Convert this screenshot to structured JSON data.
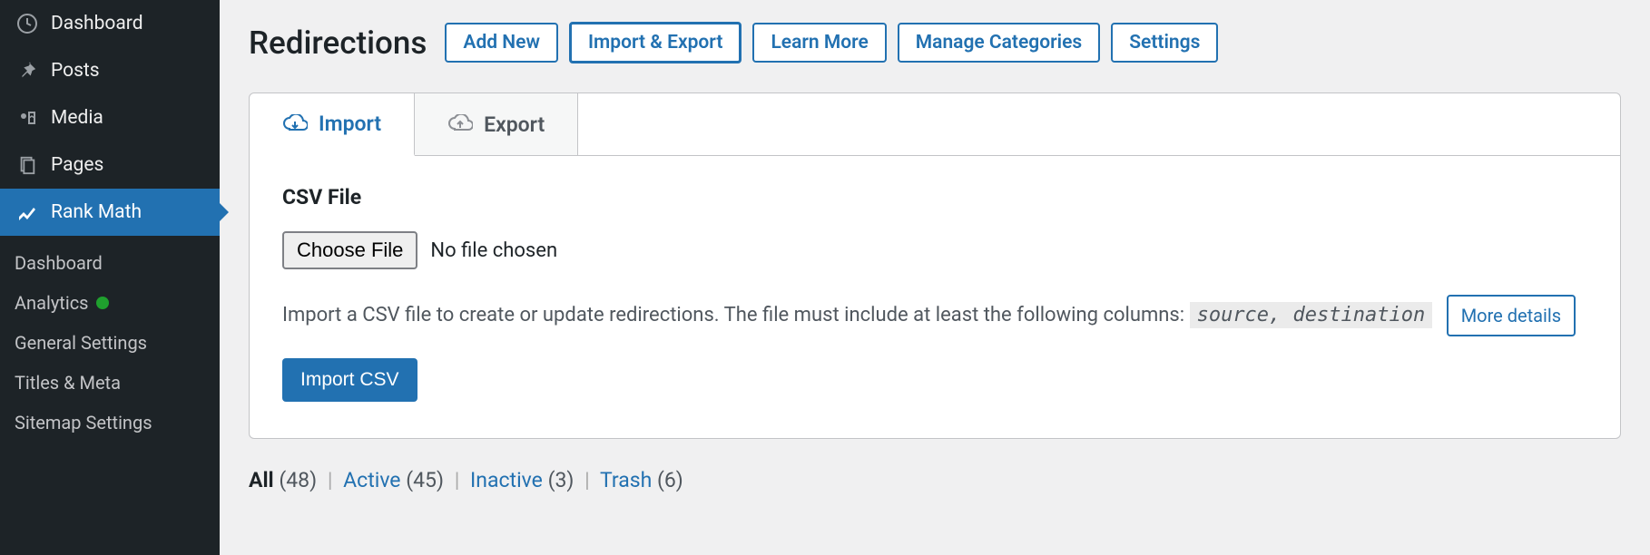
{
  "sidebar": {
    "items": [
      {
        "label": "Dashboard"
      },
      {
        "label": "Posts"
      },
      {
        "label": "Media"
      },
      {
        "label": "Pages"
      },
      {
        "label": "Rank Math"
      }
    ],
    "submenu": [
      {
        "label": "Dashboard"
      },
      {
        "label": "Analytics"
      },
      {
        "label": "General Settings"
      },
      {
        "label": "Titles & Meta"
      },
      {
        "label": "Sitemap Settings"
      }
    ]
  },
  "header": {
    "title": "Redirections",
    "buttons": {
      "add": "Add New",
      "import_export": "Import & Export",
      "learn": "Learn More",
      "manage": "Manage Categories",
      "settings": "Settings"
    }
  },
  "tabs": {
    "import": "Import",
    "export": "Export"
  },
  "form": {
    "field_label": "CSV File",
    "choose": "Choose File",
    "no_file": "No file chosen",
    "desc_pre": "Import a CSV file to create or update redirections. The file must include at least the following columns: ",
    "code": "source, destination",
    "more": "More details",
    "submit": "Import CSV"
  },
  "filters": {
    "all_label": "All",
    "all_count": "(48)",
    "active_label": "Active",
    "active_count": "(45)",
    "inactive_label": "Inactive",
    "inactive_count": "(3)",
    "trash_label": "Trash",
    "trash_count": "(6)"
  }
}
